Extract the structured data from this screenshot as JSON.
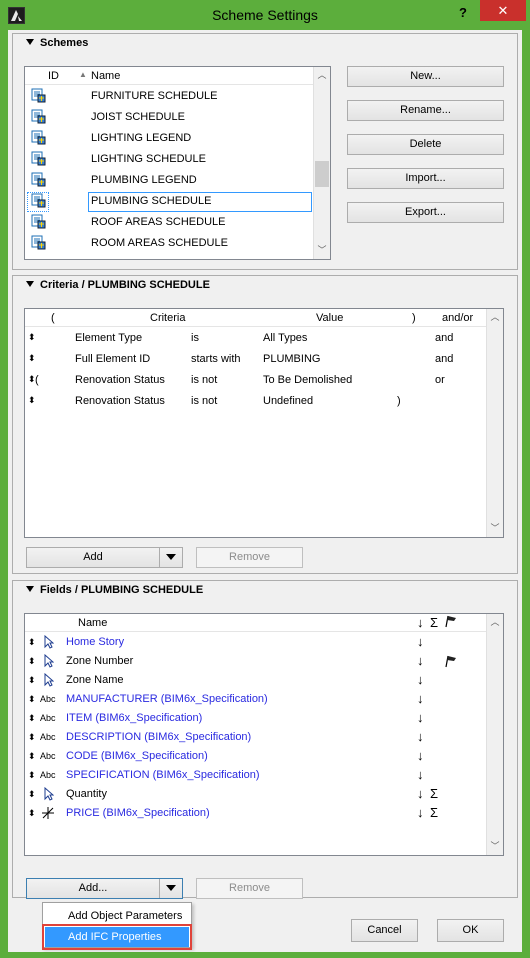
{
  "window": {
    "title": "Scheme Settings",
    "help": "?",
    "close": "✕"
  },
  "schemes": {
    "title": "Schemes",
    "columns": {
      "id": "ID",
      "name": "Name"
    },
    "items": [
      {
        "name": "FURNITURE SCHEDULE"
      },
      {
        "name": "JOIST SCHEDULE"
      },
      {
        "name": "LIGHTING LEGEND"
      },
      {
        "name": "LIGHTING SCHEDULE"
      },
      {
        "name": "PLUMBING LEGEND"
      },
      {
        "name": "PLUMBING SCHEDULE",
        "selected": true
      },
      {
        "name": "ROOF AREAS SCHEDULE"
      },
      {
        "name": "ROOM AREAS SCHEDULE"
      }
    ],
    "buttons": {
      "new": "New...",
      "rename": "Rename...",
      "delete": "Delete",
      "import": "Import...",
      "export": "Export..."
    }
  },
  "criteria": {
    "title": "Criteria /  PLUMBING SCHEDULE",
    "columns": {
      "open": "(",
      "criteria": "Criteria",
      "value": "Value",
      "close": ")",
      "andor": "and/or"
    },
    "rows": [
      {
        "open": "",
        "criteria": "Element Type",
        "op": "is",
        "value": "All Types",
        "close": "",
        "andor": "and"
      },
      {
        "open": "",
        "criteria": "Full Element ID",
        "op": "starts with",
        "value": "PLUMBING",
        "close": "",
        "andor": "and"
      },
      {
        "open": "(",
        "criteria": "Renovation Status",
        "op": "is not",
        "value": "To Be Demolished",
        "close": "",
        "andor": "or"
      },
      {
        "open": "",
        "criteria": "Renovation Status",
        "op": "is not",
        "value": "Undefined",
        "close": ")",
        "andor": ""
      }
    ],
    "add": "Add",
    "remove": "Remove"
  },
  "fields": {
    "title": "Fields /  PLUMBING SCHEDULE",
    "columns": {
      "name": "Name",
      "sort": "↓",
      "sum": "Σ"
    },
    "rows": [
      {
        "type": "pointer",
        "name": "Home Story",
        "blue": true,
        "sort": "↓",
        "sum": "",
        "flag": false
      },
      {
        "type": "pointer",
        "name": "Zone Number",
        "blue": false,
        "sort": "↓",
        "sum": "",
        "flag": true
      },
      {
        "type": "pointer",
        "name": "Zone Name",
        "blue": false,
        "sort": "↓",
        "sum": "",
        "flag": false
      },
      {
        "type": "Abc",
        "name": "MANUFACTURER (BIM6x_Specification)",
        "blue": true,
        "sort": "↓",
        "sum": "",
        "flag": false
      },
      {
        "type": "Abc",
        "name": "ITEM (BIM6x_Specification)",
        "blue": true,
        "sort": "↓",
        "sum": "",
        "flag": false
      },
      {
        "type": "Abc",
        "name": "DESCRIPTION (BIM6x_Specification)",
        "blue": true,
        "sort": "↓",
        "sum": "",
        "flag": false
      },
      {
        "type": "Abc",
        "name": "CODE (BIM6x_Specification)",
        "blue": true,
        "sort": "↓",
        "sum": "",
        "flag": false
      },
      {
        "type": "Abc",
        "name": "SPECIFICATION (BIM6x_Specification)",
        "blue": true,
        "sort": "↓",
        "sum": "",
        "flag": false
      },
      {
        "type": "pointer",
        "name": "Quantity",
        "blue": false,
        "sort": "↓",
        "sum": "Σ",
        "flag": false
      },
      {
        "type": "cross",
        "name": "PRICE (BIM6x_Specification)",
        "blue": true,
        "sort": "↓",
        "sum": "Σ",
        "flag": false
      }
    ],
    "add": "Add...",
    "remove": "Remove"
  },
  "add_menu": {
    "items": [
      "Add Object Parameters",
      "Add IFC Properties"
    ],
    "highlighted": 1
  },
  "footer": {
    "cancel": "Cancel",
    "ok": "OK"
  },
  "colors": {
    "title_bar": "#5cae3c",
    "close": "#c9302c",
    "link_blue": "#2a2ae0",
    "highlight": "#3399ff",
    "highlight_outline": "#e0433a"
  }
}
